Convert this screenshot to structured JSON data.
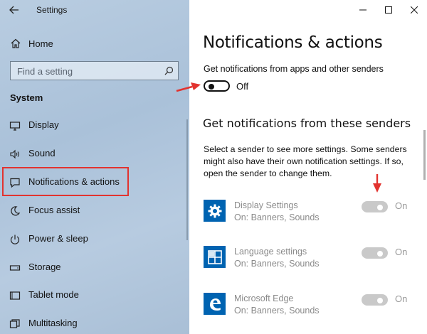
{
  "window": {
    "title": "Settings",
    "controls": [
      "minimize",
      "maximize",
      "close"
    ]
  },
  "sidebar": {
    "home_label": "Home",
    "search_placeholder": "Find a setting",
    "section_heading": "System",
    "items": [
      {
        "label": "Display",
        "icon": "monitor-icon"
      },
      {
        "label": "Sound",
        "icon": "speaker-icon"
      },
      {
        "label": "Notifications & actions",
        "icon": "message-icon",
        "active": true
      },
      {
        "label": "Focus assist",
        "icon": "moon-icon"
      },
      {
        "label": "Power & sleep",
        "icon": "power-icon"
      },
      {
        "label": "Storage",
        "icon": "drive-icon"
      },
      {
        "label": "Tablet mode",
        "icon": "tablet-icon"
      },
      {
        "label": "Multitasking",
        "icon": "multitask-icon"
      }
    ]
  },
  "content": {
    "title": "Notifications & actions",
    "get_notifications_label": "Get notifications from apps and other senders",
    "main_toggle_state": "Off",
    "senders_heading": "Get notifications from these senders",
    "senders_description": "Select a sender to see more settings. Some senders might also have their own notification settings. If so, open the sender to change them.",
    "senders": [
      {
        "name": "Display Settings",
        "detail": "On: Banners, Sounds",
        "state": "On",
        "icon": "gear-icon"
      },
      {
        "name": "Language settings",
        "detail": "On: Banners, Sounds",
        "state": "On",
        "icon": "language-icon"
      },
      {
        "name": "Microsoft Edge",
        "detail": "On: Banners, Sounds",
        "state": "On",
        "icon": "edge-icon"
      }
    ]
  },
  "colors": {
    "accent": "#0063b1",
    "annotation_red": "#e2332f"
  }
}
